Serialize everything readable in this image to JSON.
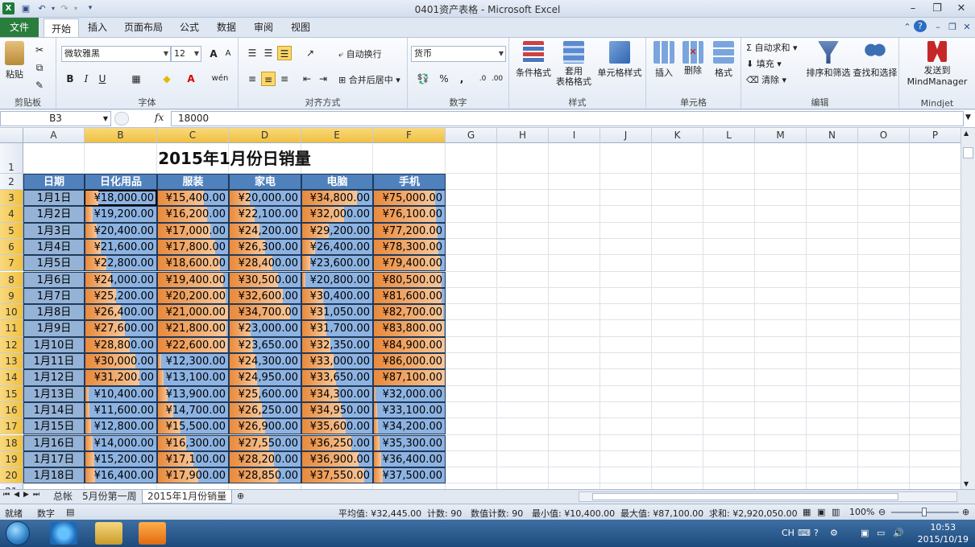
{
  "window": {
    "title": "0401资产表格 - Microsoft Excel"
  },
  "tabs": {
    "file": "文件",
    "home": "开始",
    "insert": "插入",
    "layout": "页面布局",
    "formulas": "公式",
    "data": "数据",
    "review": "审阅",
    "view": "视图"
  },
  "ribbon": {
    "clipboard": {
      "paste": "粘贴",
      "label": "剪贴板"
    },
    "font": {
      "name": "微软雅黑",
      "size": "12",
      "bold": "B",
      "italic": "I",
      "underline": "U",
      "label": "字体",
      "phonetic": "wén"
    },
    "align": {
      "wrap": "自动换行",
      "merge": "合并后居中",
      "label": "对齐方式"
    },
    "number": {
      "format": "货币",
      "percent": "%",
      "comma": ",",
      "label": "数字"
    },
    "styles": {
      "cond": "条件格式",
      "table1": "套用",
      "table2": "表格格式",
      "cell": "单元格样式",
      "label": "样式"
    },
    "cells": {
      "insert": "插入",
      "delete": "删除",
      "format": "格式",
      "label": "单元格"
    },
    "editing": {
      "autosum": "自动求和",
      "fill": "填充",
      "clear": "清除",
      "sort": "排序和筛选",
      "find": "查找和选择",
      "label": "编辑"
    },
    "mindjet": {
      "send1": "发送到",
      "send2": "MindManager",
      "label": "Mindjet"
    }
  },
  "formula_bar": {
    "name_box": "B3",
    "fx": "fx",
    "value": "18000"
  },
  "columns": [
    "A",
    "B",
    "C",
    "D",
    "E",
    "F",
    "G",
    "H",
    "I",
    "J",
    "K",
    "L",
    "M",
    "N",
    "O",
    "P"
  ],
  "sheet": {
    "title": "2015年1月份日销量",
    "headers": [
      "日期",
      "日化用品",
      "服装",
      "家电",
      "电脑",
      "手机"
    ],
    "rows": [
      {
        "date": "1月1日",
        "vals": [
          "¥18,000.00",
          "¥15,400.00",
          "¥20,000.00",
          "¥34,800.00",
          "¥75,000.00"
        ]
      },
      {
        "date": "1月2日",
        "vals": [
          "¥19,200.00",
          "¥16,200.00",
          "¥22,100.00",
          "¥32,000.00",
          "¥76,100.00"
        ]
      },
      {
        "date": "1月3日",
        "vals": [
          "¥20,400.00",
          "¥17,000.00",
          "¥24,200.00",
          "¥29,200.00",
          "¥77,200.00"
        ]
      },
      {
        "date": "1月4日",
        "vals": [
          "¥21,600.00",
          "¥17,800.00",
          "¥26,300.00",
          "¥26,400.00",
          "¥78,300.00"
        ]
      },
      {
        "date": "1月5日",
        "vals": [
          "¥22,800.00",
          "¥18,600.00",
          "¥28,400.00",
          "¥23,600.00",
          "¥79,400.00"
        ]
      },
      {
        "date": "1月6日",
        "vals": [
          "¥24,000.00",
          "¥19,400.00",
          "¥30,500.00",
          "¥20,800.00",
          "¥80,500.00"
        ]
      },
      {
        "date": "1月7日",
        "vals": [
          "¥25,200.00",
          "¥20,200.00",
          "¥32,600.00",
          "¥30,400.00",
          "¥81,600.00"
        ]
      },
      {
        "date": "1月8日",
        "vals": [
          "¥26,400.00",
          "¥21,000.00",
          "¥34,700.00",
          "¥31,050.00",
          "¥82,700.00"
        ]
      },
      {
        "date": "1月9日",
        "vals": [
          "¥27,600.00",
          "¥21,800.00",
          "¥23,000.00",
          "¥31,700.00",
          "¥83,800.00"
        ]
      },
      {
        "date": "1月10日",
        "vals": [
          "¥28,800.00",
          "¥22,600.00",
          "¥23,650.00",
          "¥32,350.00",
          "¥84,900.00"
        ]
      },
      {
        "date": "1月11日",
        "vals": [
          "¥30,000.00",
          "¥12,300.00",
          "¥24,300.00",
          "¥33,000.00",
          "¥86,000.00"
        ]
      },
      {
        "date": "1月12日",
        "vals": [
          "¥31,200.00",
          "¥13,100.00",
          "¥24,950.00",
          "¥33,650.00",
          "¥87,100.00"
        ]
      },
      {
        "date": "1月13日",
        "vals": [
          "¥10,400.00",
          "¥13,900.00",
          "¥25,600.00",
          "¥34,300.00",
          "¥32,000.00"
        ]
      },
      {
        "date": "1月14日",
        "vals": [
          "¥11,600.00",
          "¥14,700.00",
          "¥26,250.00",
          "¥34,950.00",
          "¥33,100.00"
        ]
      },
      {
        "date": "1月15日",
        "vals": [
          "¥12,800.00",
          "¥15,500.00",
          "¥26,900.00",
          "¥35,600.00",
          "¥34,200.00"
        ]
      },
      {
        "date": "1月16日",
        "vals": [
          "¥14,000.00",
          "¥16,300.00",
          "¥27,550.00",
          "¥36,250.00",
          "¥35,300.00"
        ]
      },
      {
        "date": "1月17日",
        "vals": [
          "¥15,200.00",
          "¥17,100.00",
          "¥28,200.00",
          "¥36,900.00",
          "¥36,400.00"
        ]
      },
      {
        "date": "1月18日",
        "vals": [
          "¥16,400.00",
          "¥17,900.00",
          "¥28,850.00",
          "¥37,550.00",
          "¥37,500.00"
        ]
      }
    ],
    "bar_fractions": [
      [
        0.18,
        0.65,
        0.28,
        0.78,
        0.86
      ],
      [
        0.1,
        0.7,
        0.35,
        0.6,
        0.88
      ],
      [
        0.16,
        0.75,
        0.42,
        0.38,
        0.9
      ],
      [
        0.22,
        0.82,
        0.5,
        0.18,
        0.91
      ],
      [
        0.29,
        0.88,
        0.6,
        0.12,
        0.93
      ],
      [
        0.36,
        0.93,
        0.68,
        0.05,
        0.95
      ],
      [
        0.43,
        0.97,
        0.75,
        0.3,
        0.96
      ],
      [
        0.5,
        1.0,
        0.85,
        0.32,
        0.98
      ],
      [
        0.56,
        0.98,
        0.3,
        0.35,
        0.99
      ],
      [
        0.63,
        0.99,
        0.33,
        0.4,
        1.0
      ],
      [
        0.7,
        0.05,
        0.36,
        0.45,
        1.0
      ],
      [
        0.76,
        0.08,
        0.39,
        0.48,
        1.0
      ],
      [
        0.04,
        0.14,
        0.42,
        0.52,
        0.02
      ],
      [
        0.06,
        0.22,
        0.46,
        0.56,
        0.04
      ],
      [
        0.08,
        0.32,
        0.5,
        0.62,
        0.06
      ],
      [
        0.1,
        0.4,
        0.56,
        0.7,
        0.08
      ],
      [
        0.12,
        0.5,
        0.62,
        0.8,
        0.1
      ],
      [
        0.14,
        0.58,
        0.68,
        0.88,
        0.12
      ]
    ]
  },
  "sheet_tabs": [
    "总帐",
    "5月份第一周",
    "2015年1月份销量"
  ],
  "status": {
    "ready": "就绪",
    "mode": "数字",
    "avg": "平均值: ¥32,445.00",
    "count": "计数: 90",
    "numcount": "数值计数: 90",
    "min": "最小值: ¥10,400.00",
    "max": "最大值: ¥87,100.00",
    "sum": "求和: ¥2,920,050.00",
    "zoom": "100%"
  },
  "taskbar": {
    "lang": "CH",
    "time": "10:53",
    "date": "2015/10/19"
  },
  "colors": {
    "header_blue": "#4f81bd",
    "cell_blue": "#8db3e2",
    "bar_orange": "#e98a3c",
    "file_green": "#2a7d3d"
  }
}
